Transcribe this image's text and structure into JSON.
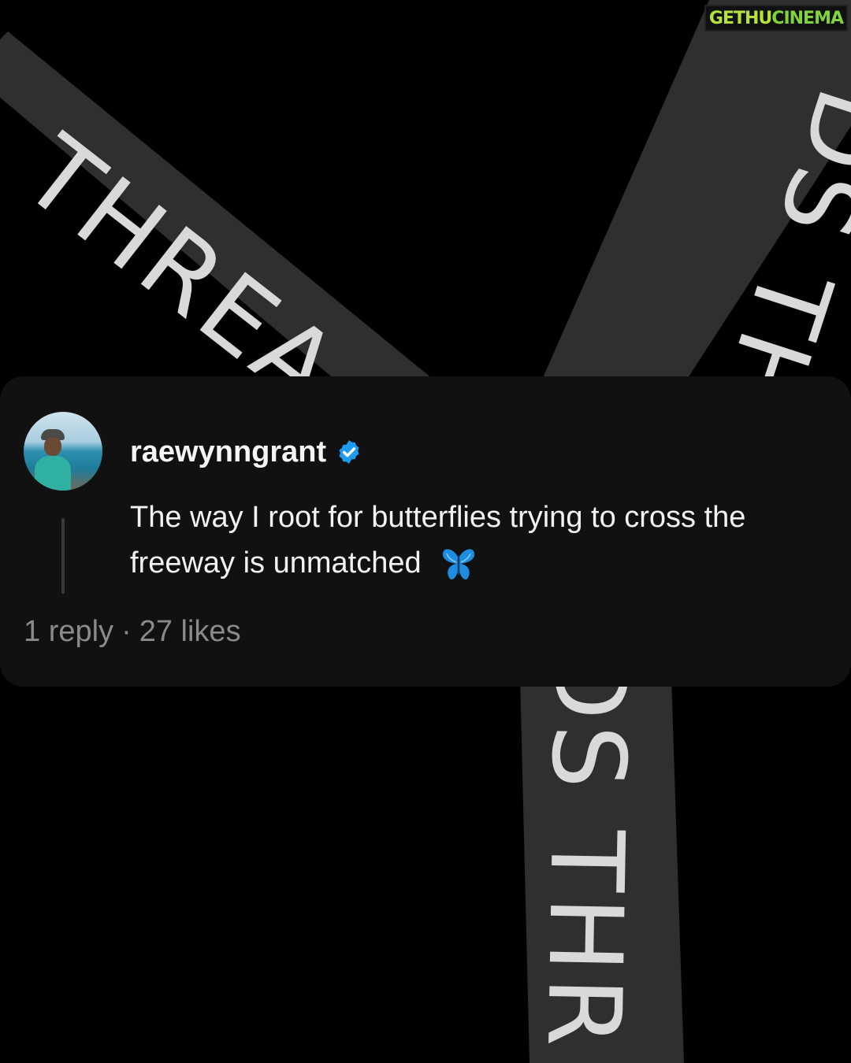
{
  "background": {
    "color": "#000000",
    "ribbon_color": "#2f2f2f",
    "ribbon_text_color": "#d9d9d9",
    "ribbon_left_text": "THREA",
    "ribbon_right_text": "DS TH",
    "ribbon_bottom_text": "DS THR"
  },
  "watermark": {
    "part1": "GETHU",
    "part2": "CINEMA"
  },
  "comment": {
    "avatar": "profile-photo",
    "username": "raewynngrant",
    "verified": true,
    "verified_color": "#1d9bf0",
    "text": "The way I root for butterflies trying to cross the freeway is unmatched",
    "emoji": "🦋",
    "replies": "1 reply",
    "separator": "·",
    "likes": "27 likes"
  }
}
